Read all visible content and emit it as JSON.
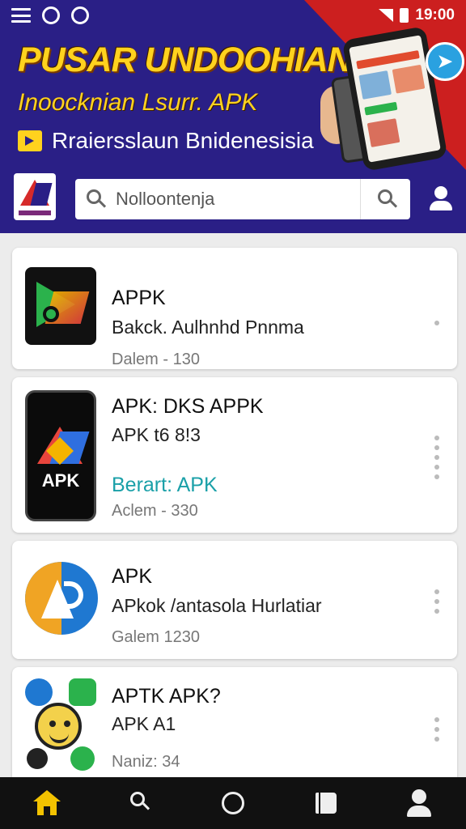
{
  "status_bar": {
    "time": "19:00"
  },
  "banner": {
    "title": "PUSAR UNDOOHIAN",
    "subtitle": "Inoocknian Lsurr. APK",
    "tagline": "Rraiersslaun Bnidenesisia"
  },
  "search": {
    "placeholder": "Nolloontenja"
  },
  "apps": [
    {
      "title": "APPK",
      "subtitle": "Bakck. Aulhnhd Pnnma",
      "meta": "Dalem - 130"
    },
    {
      "title": "APK: DKS APPK",
      "subtitle": "APK t6 8!3",
      "accent": "Berart: APK",
      "meta": "Aclem - 330",
      "icon_label": "APK"
    },
    {
      "title": "APK",
      "subtitle": "APkok /antasola Hurlatiar",
      "meta": "Galem 1230"
    },
    {
      "title": "APTK APK?",
      "subtitle": "APK A1",
      "meta": "Naniz: 34"
    }
  ],
  "colors": {
    "header_bg": "#2a1f86",
    "accent_red": "#cc1f1f",
    "banner_yellow": "#ffd21e",
    "accent_teal": "#1aa0a8",
    "nav_active": "#f2c200"
  },
  "icons": [
    "menu-icon",
    "app-icon",
    "search-icon",
    "user-icon",
    "home-icon",
    "circle-icon",
    "book-icon",
    "profile-icon",
    "more-vert-icon"
  ]
}
